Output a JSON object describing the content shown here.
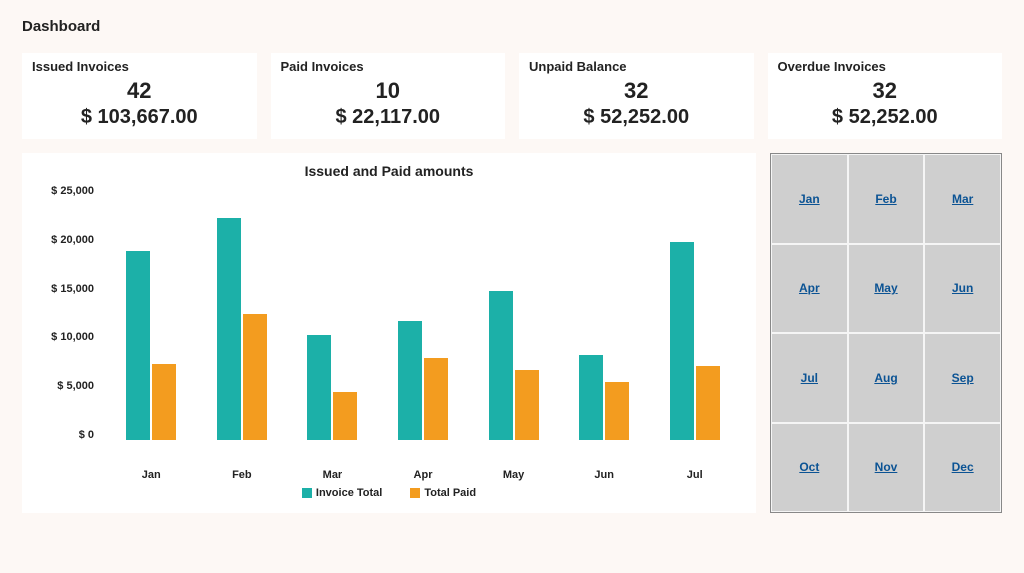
{
  "title": "Dashboard",
  "cards": [
    {
      "label": "Issued Invoices",
      "count": "42",
      "amount": "$ 103,667.00"
    },
    {
      "label": "Paid Invoices",
      "count": "10",
      "amount": "$ 22,117.00"
    },
    {
      "label": "Unpaid Balance",
      "count": "32",
      "amount": "$ 52,252.00"
    },
    {
      "label": "Overdue Invoices",
      "count": "32",
      "amount": "$ 52,252.00"
    }
  ],
  "chart_data": {
    "type": "bar",
    "title": "Issued and Paid amounts",
    "categories": [
      "Jan",
      "Feb",
      "Mar",
      "Apr",
      "May",
      "Jun",
      "Jul"
    ],
    "series": [
      {
        "name": "Invoice Total",
        "color": "#1cb0a8",
        "values": [
          18500,
          21700,
          10300,
          11600,
          14600,
          8300,
          19300
        ]
      },
      {
        "name": "Total Paid",
        "color": "#f39c1f",
        "values": [
          7400,
          12300,
          4700,
          8000,
          6800,
          5700,
          7200
        ]
      }
    ],
    "ylabel": "",
    "xlabel": "",
    "ylim": [
      0,
      25000
    ],
    "yticks": [
      "$ 25,000",
      "$ 20,000",
      "$ 15,000",
      "$ 10,000",
      "$ 5,000",
      "$ 0"
    ]
  },
  "months": [
    "Jan",
    "Feb",
    "Mar",
    "Apr",
    "May",
    "Jun",
    "Jul",
    "Aug",
    "Sep",
    "Oct",
    "Nov",
    "Dec"
  ]
}
